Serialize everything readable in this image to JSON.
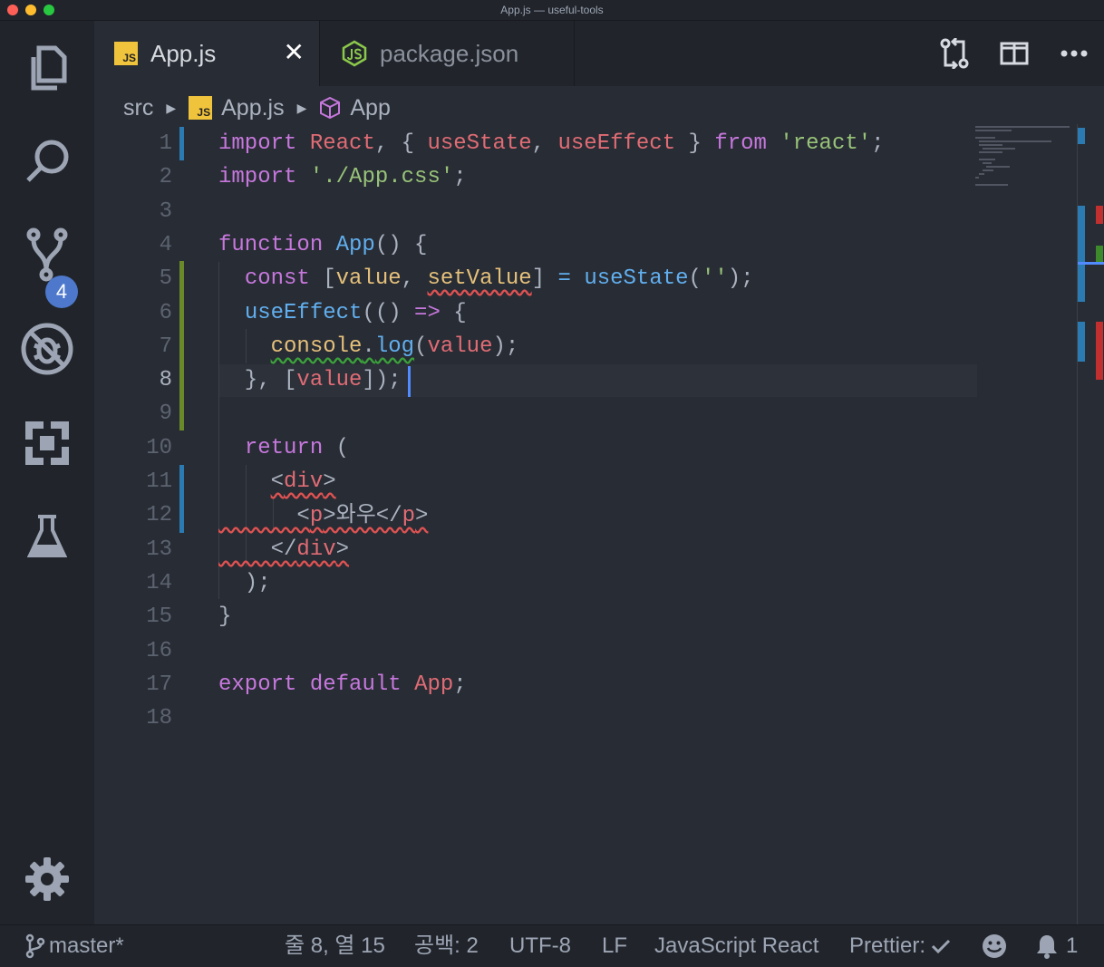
{
  "window": {
    "title": "App.js — useful-tools"
  },
  "activity_bar": {
    "items": [
      {
        "name": "explorer-icon"
      },
      {
        "name": "search-icon"
      },
      {
        "name": "source-control-icon",
        "badge": "4"
      },
      {
        "name": "debug-icon"
      },
      {
        "name": "extensions-icon"
      },
      {
        "name": "test-flask-icon"
      }
    ],
    "settings": "gear-icon"
  },
  "tabs": [
    {
      "label": "App.js",
      "active": true,
      "icon": "js-file-icon",
      "icon_text": "JS",
      "close": "✕"
    },
    {
      "label": "package.json",
      "active": false,
      "icon": "nodejs-icon"
    }
  ],
  "tab_actions": [
    "compare-changes-icon",
    "split-editor-icon",
    "more-actions-icon"
  ],
  "breadcrumb": {
    "folder": "src",
    "file": "App.js",
    "file_icon_text": "JS",
    "symbol": "App"
  },
  "editor": {
    "line_numbers": [
      "1",
      "2",
      "3",
      "4",
      "5",
      "6",
      "7",
      "8",
      "9",
      "10",
      "11",
      "12",
      "13",
      "14",
      "15",
      "16",
      "17",
      "18"
    ],
    "active_line": 8
  },
  "status_bar": {
    "branch": "master*",
    "position": "줄 8, 열 15",
    "indent": "공백: 2",
    "encoding": "UTF-8",
    "eol": "LF",
    "language": "JavaScript React",
    "formatter": "Prettier:",
    "notifications": "1"
  },
  "colors": {
    "accent": "#4d78cc",
    "keyword": "#c678dd",
    "variable": "#e06c75",
    "string": "#98c379",
    "function": "#61afef",
    "error": "#e05252"
  }
}
